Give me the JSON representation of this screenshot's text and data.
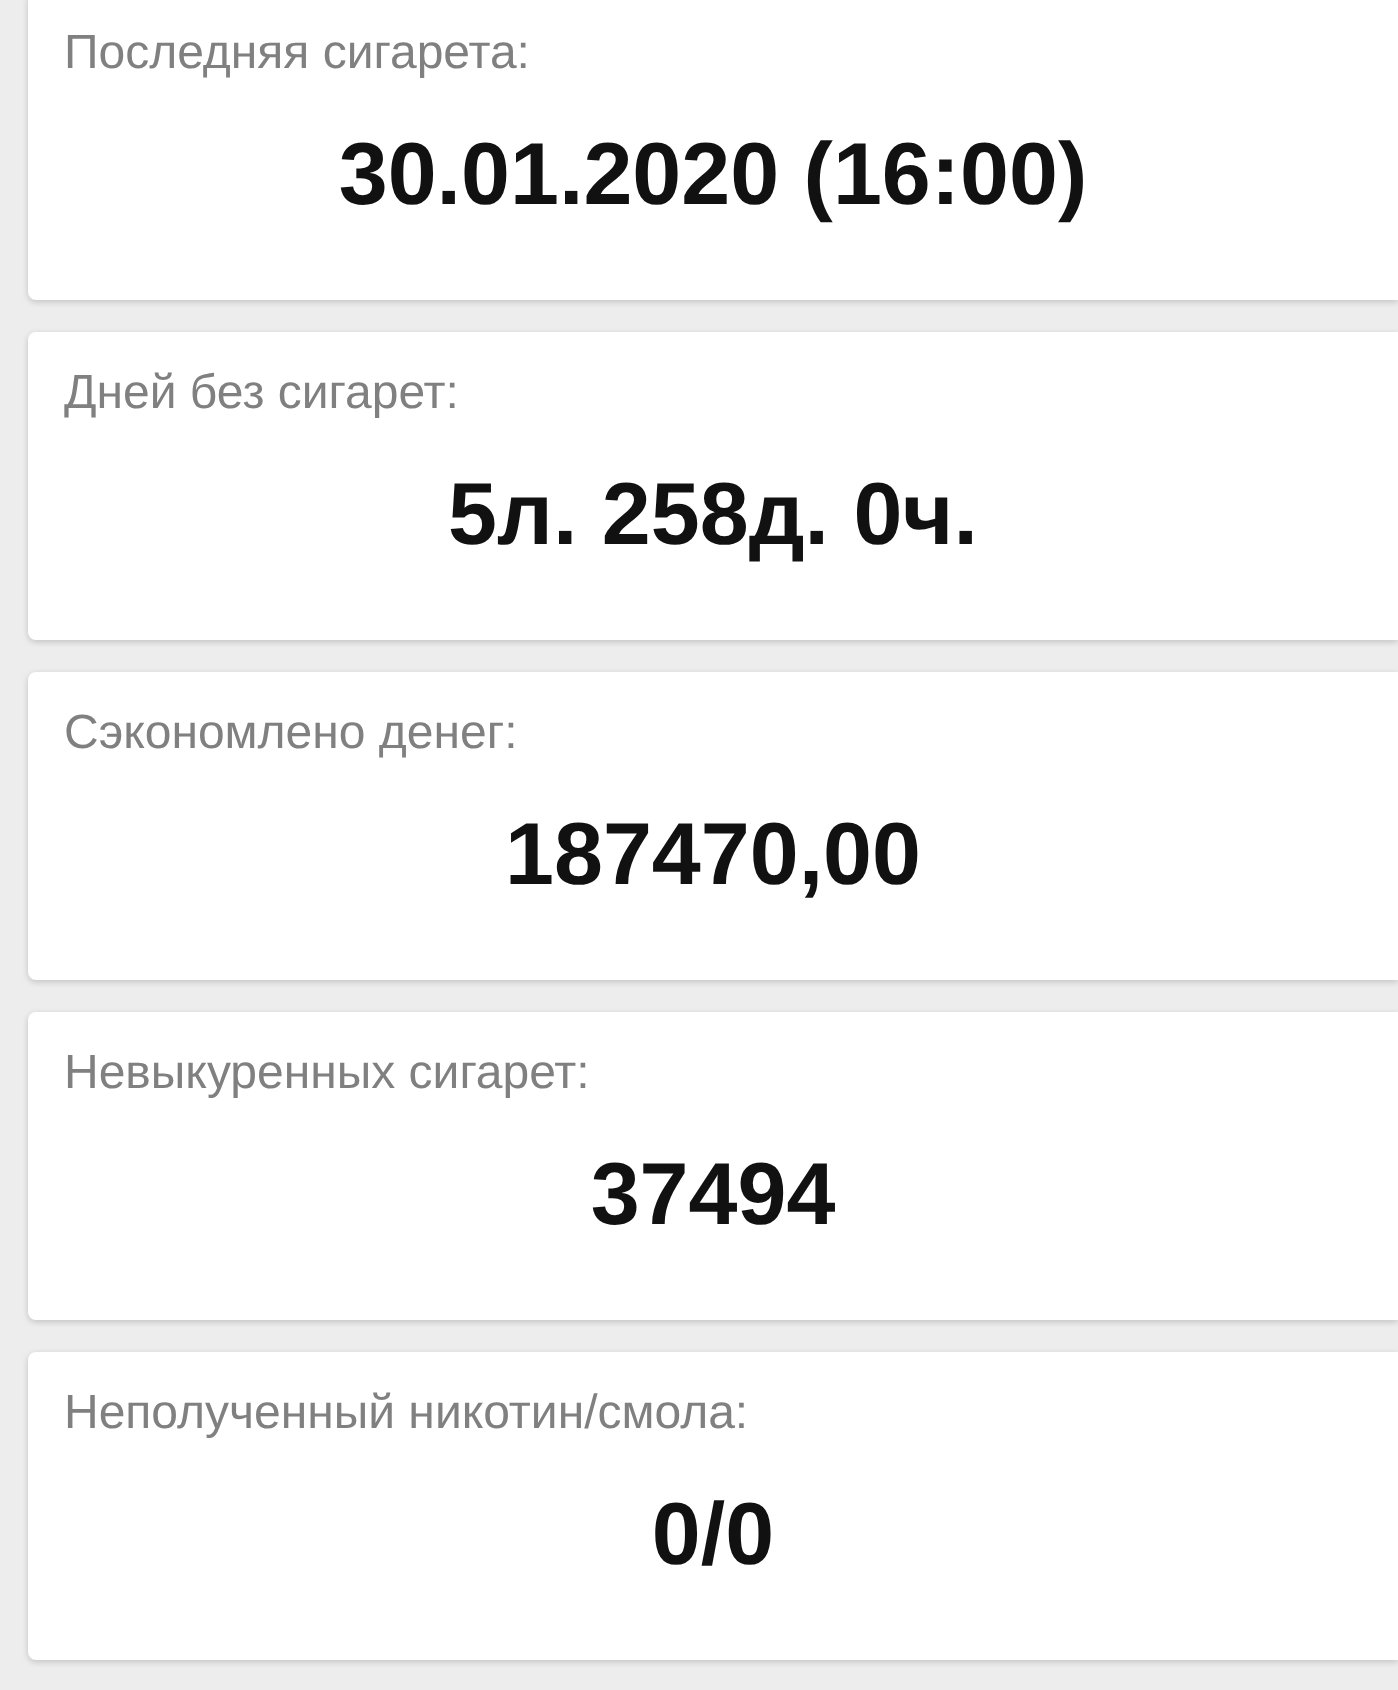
{
  "cards": [
    {
      "label": "Последняя сигарета:",
      "value": "30.01.2020 (16:00)"
    },
    {
      "label": "Дней без сигарет:",
      "value": "5л. 258д. 0ч."
    },
    {
      "label": "Сэкономлено денег:",
      "value": "187470,00"
    },
    {
      "label": "Невыкуренных сигарет:",
      "value": "37494"
    },
    {
      "label": "Неполученный никотин/смола:",
      "value": "0/0"
    }
  ]
}
